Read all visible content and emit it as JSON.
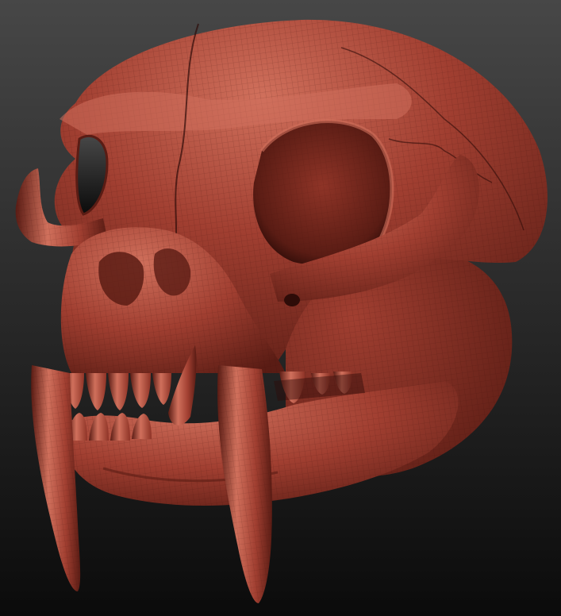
{
  "scene": {
    "subject": "skull-sculpt",
    "background": {
      "top": "#474747",
      "bottom": "#0b0b0b"
    },
    "material": {
      "base": "#a13f31",
      "light": "#d0705c",
      "mid": "#8f3427",
      "shadow": "#5a1c14",
      "deep": "#2e0c08",
      "wire": "#3a0e09"
    }
  }
}
